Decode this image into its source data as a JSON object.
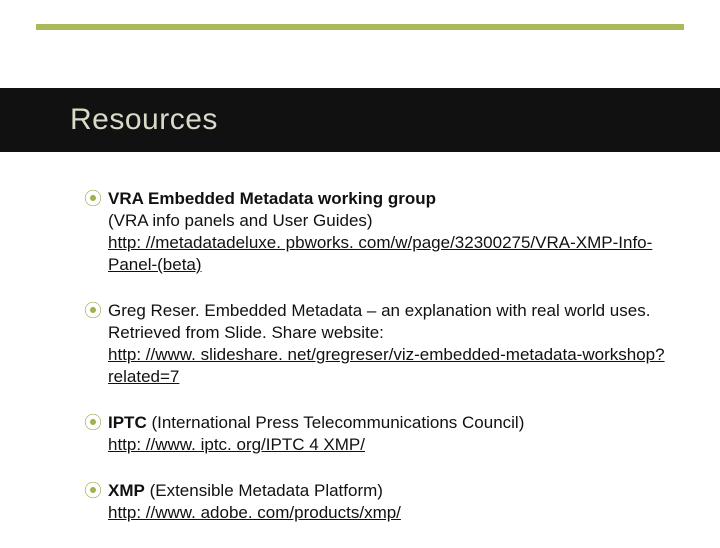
{
  "title": "Resources",
  "items": [
    {
      "boldLead": "VRA Embedded Metadata working group",
      "plain": "(VRA info panels and User Guides)",
      "extra": "",
      "link": "http: //metadatadeluxe. pbworks. com/w/page/32300275/VRA-XMP-Info-Panel-(beta)"
    },
    {
      "plain": "Greg Reser. Embedded Metadata – an explanation with real world uses. Retrieved from Slide. Share website:",
      "link": "http: //www. slideshare. net/gregreser/viz-embedded-metadata-workshop? related=7"
    },
    {
      "boldLead": "IPTC",
      "plainInline": " (International Press Telecommunications Council)",
      "link": "http: //www. iptc. org/IPTC 4 XMP/"
    },
    {
      "boldLead": "XMP",
      "plainInline": " (Extensible Metadata Platform)",
      "link": "http: //www. adobe. com/products/xmp/"
    }
  ]
}
